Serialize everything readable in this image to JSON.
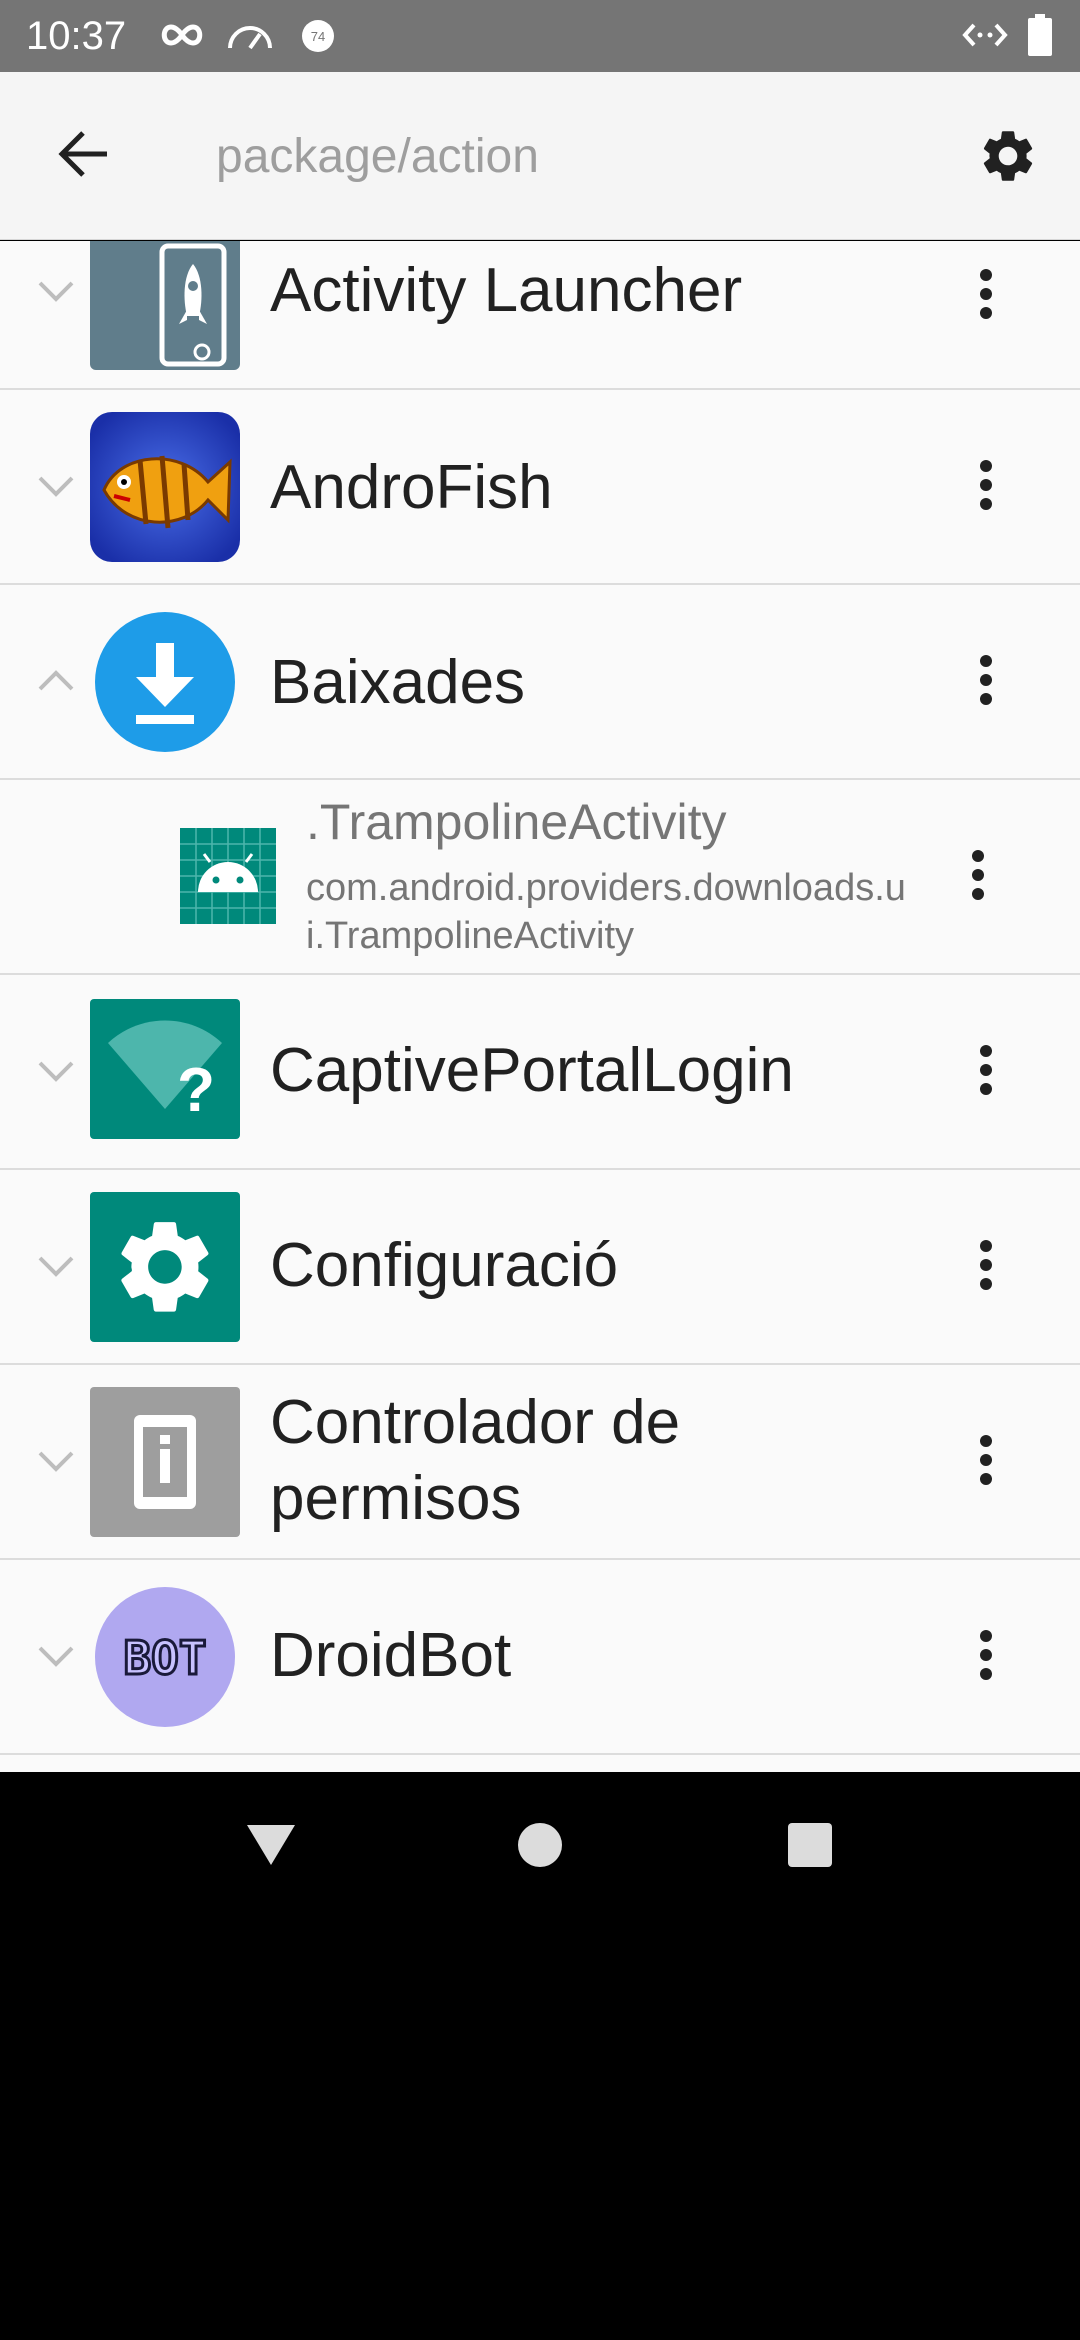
{
  "status_bar": {
    "time": "10:37",
    "icons": [
      "infinity-icon",
      "speedometer-icon",
      "notification-74-icon",
      "code-arrows-icon",
      "battery-icon"
    ],
    "badge_number": "74"
  },
  "app_bar": {
    "search_placeholder": "package/action",
    "back_icon": "arrow-left-icon",
    "settings_icon": "gear-icon"
  },
  "apps": [
    {
      "label": "Activity Launcher",
      "expanded": false,
      "icon": "rocket-launcher-icon"
    },
    {
      "label": "AndroFish",
      "expanded": false,
      "icon": "fish-icon"
    },
    {
      "label": "Baixades",
      "expanded": true,
      "icon": "download-icon",
      "activities": [
        {
          "title": ".TrampolineActivity",
          "package": "com.android.providers.downloads.ui.TrampolineActivity",
          "icon": "android-icon"
        }
      ]
    },
    {
      "label": "CaptivePortalLogin",
      "expanded": false,
      "icon": "wifi-question-icon"
    },
    {
      "label": "Configuració",
      "expanded": false,
      "icon": "settings-gear-icon"
    },
    {
      "label": "Controlador de permisos",
      "expanded": false,
      "icon": "phone-info-icon"
    },
    {
      "label": "DroidBot",
      "expanded": false,
      "icon": "bot-icon",
      "icon_text": "BOT"
    }
  ],
  "nav_bar": {
    "back": "triangle-back-icon",
    "home": "circle-home-icon",
    "recents": "square-recents-icon"
  },
  "colors": {
    "status_bar": "#757575",
    "app_bar": "#f5f5f5",
    "list_bg": "#fafafa",
    "teal": "#00897b",
    "download_blue": "#1e9ce8",
    "divider": "#dcdcdc"
  }
}
